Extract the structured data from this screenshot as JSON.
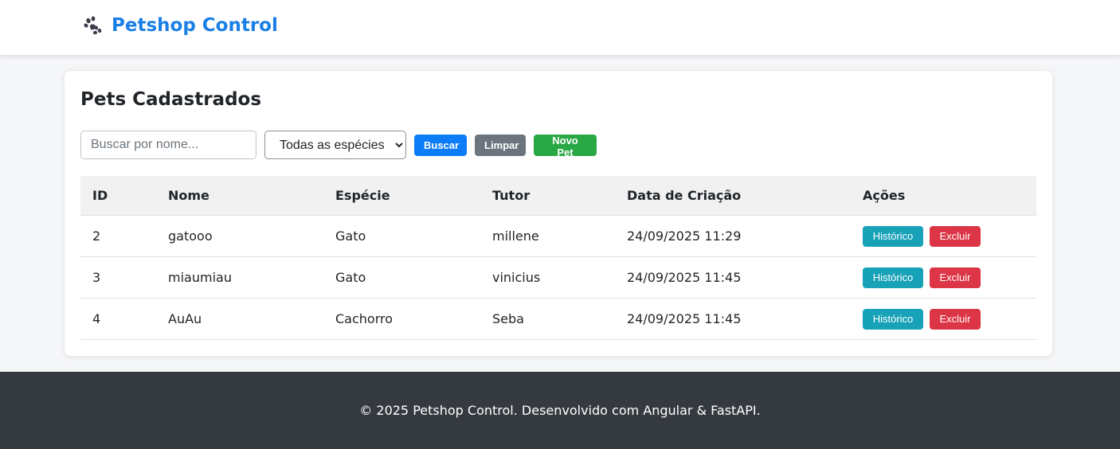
{
  "header": {
    "brand_icon": "paw-icon",
    "title": "Petshop Control",
    "brand_color": "#1a7fe6"
  },
  "main": {
    "title": "Pets Cadastrados",
    "search": {
      "placeholder": "Buscar por nome...",
      "value": ""
    },
    "species_filter": {
      "selected": "Todas as espécies"
    },
    "buttons": {
      "search": "Buscar",
      "clear": "Limpar",
      "new_pet": "Novo Pet"
    },
    "table": {
      "headers": [
        "ID",
        "Nome",
        "Espécie",
        "Tutor",
        "Data de Criação",
        "Ações"
      ],
      "rows": [
        {
          "id": "2",
          "nome": "gatooo",
          "especie": "Gato",
          "tutor": "millene",
          "data": "24/09/2025 11:29",
          "historico": "Histórico",
          "excluir": "Excluir"
        },
        {
          "id": "3",
          "nome": "miaumiau",
          "especie": "Gato",
          "tutor": "vinicius",
          "data": "24/09/2025 11:45",
          "historico": "Histórico",
          "excluir": "Excluir"
        },
        {
          "id": "4",
          "nome": "AuAu",
          "especie": "Cachorro",
          "tutor": "Seba",
          "data": "24/09/2025 11:45",
          "historico": "Histórico",
          "excluir": "Excluir"
        }
      ]
    }
  },
  "footer": {
    "text": "© 2025 Petshop Control. Desenvolvido com Angular & FastAPI."
  },
  "colors": {
    "primary": "#0d7cf7",
    "secondary": "#6c757d",
    "success": "#28a745",
    "info": "#17a2b8",
    "danger": "#dc3545",
    "footer_bg": "#343a40"
  }
}
